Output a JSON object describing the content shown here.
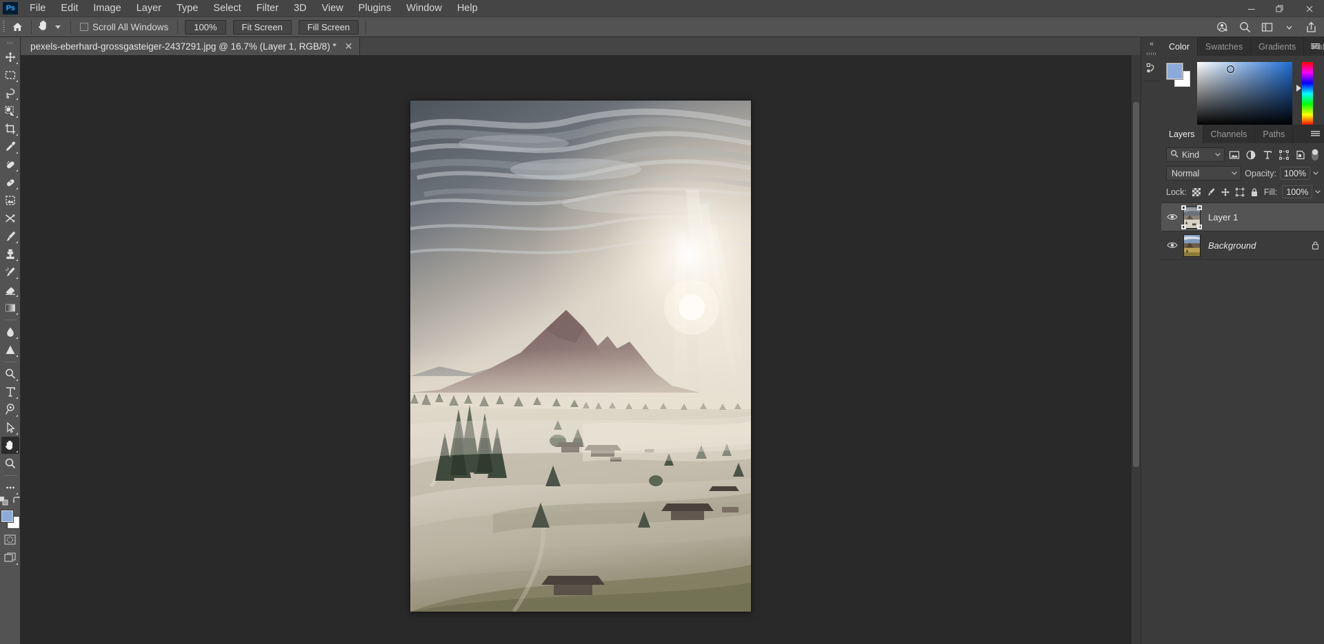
{
  "app": {
    "name": "Adobe Photoshop",
    "logo_text": "Ps"
  },
  "menubar": {
    "items": [
      {
        "label": "File"
      },
      {
        "label": "Edit"
      },
      {
        "label": "Image"
      },
      {
        "label": "Layer"
      },
      {
        "label": "Type"
      },
      {
        "label": "Select"
      },
      {
        "label": "Filter"
      },
      {
        "label": "3D"
      },
      {
        "label": "View"
      },
      {
        "label": "Plugins"
      },
      {
        "label": "Window"
      },
      {
        "label": "Help"
      }
    ],
    "window_controls": {
      "minimize": "—",
      "restore": "❐",
      "close": "✕"
    }
  },
  "options_bar": {
    "home_icon": "home-icon",
    "active_tool_icon": "hand-tool-icon",
    "scroll_all_windows_label": "Scroll All Windows",
    "scroll_all_windows_checked": false,
    "zoom_100_label": "100%",
    "fit_screen_label": "Fit Screen",
    "fill_screen_label": "Fill Screen",
    "right_icons": [
      {
        "name": "share-user-icon"
      },
      {
        "name": "search-icon"
      },
      {
        "name": "workspace-icon"
      },
      {
        "name": "chevron-down-icon"
      },
      {
        "name": "share-export-icon"
      }
    ]
  },
  "toolbar": {
    "tools": [
      {
        "name": "move-tool",
        "label": "Move Tool",
        "icon": "move-icon",
        "has_flyout": true,
        "active": false
      },
      {
        "name": "marquee-tool",
        "label": "Rectangular Marquee Tool",
        "icon": "marquee-icon",
        "has_flyout": true,
        "active": false
      },
      {
        "name": "lasso-tool",
        "label": "Lasso Tool",
        "icon": "lasso-icon",
        "has_flyout": true,
        "active": false
      },
      {
        "name": "quick-selection-tool",
        "label": "Object Selection Tool",
        "icon": "quick-select-icon",
        "has_flyout": true,
        "active": false
      },
      {
        "name": "crop-tool",
        "label": "Crop Tool",
        "icon": "crop-icon",
        "has_flyout": true,
        "active": false
      },
      {
        "name": "eyedropper-tool",
        "label": "Eyedropper Tool",
        "icon": "eyedropper-icon",
        "has_flyout": true,
        "active": false
      },
      {
        "name": "spot-healing-tool",
        "label": "Spot Healing Brush Tool",
        "icon": "healing-brush-icon",
        "has_flyout": true,
        "active": false
      },
      {
        "name": "patch-tool",
        "label": "Patch Tool",
        "icon": "patch-icon",
        "has_flyout": true,
        "active": false
      },
      {
        "name": "frame-tool",
        "label": "Frame Tool",
        "icon": "frame-icon",
        "has_flyout": false,
        "active": false
      },
      {
        "name": "shuffle-tool",
        "label": "Content-Aware Move Tool",
        "icon": "shuffle-icon",
        "has_flyout": false,
        "active": false
      },
      {
        "name": "brush-tool",
        "label": "Brush Tool",
        "icon": "brush-icon",
        "has_flyout": true,
        "active": false
      },
      {
        "name": "clone-stamp-tool",
        "label": "Clone Stamp Tool",
        "icon": "clone-stamp-icon",
        "has_flyout": true,
        "active": false
      },
      {
        "name": "history-brush-tool",
        "label": "History Brush Tool",
        "icon": "history-brush-icon",
        "has_flyout": true,
        "active": false
      },
      {
        "name": "eraser-tool",
        "label": "Eraser Tool",
        "icon": "eraser-icon",
        "has_flyout": true,
        "active": false
      },
      {
        "name": "gradient-tool",
        "label": "Gradient Tool",
        "icon": "gradient-icon",
        "has_flyout": true,
        "active": false
      },
      {
        "name": "blur-tool",
        "label": "Blur Tool",
        "icon": "waterdrop-icon",
        "has_flyout": true,
        "active": false
      },
      {
        "name": "dodge-tool",
        "label": "Dodge Tool",
        "icon": "dodge-icon",
        "has_flyout": true,
        "active": false
      },
      {
        "name": "pen-tool",
        "label": "Pen Tool",
        "icon": "pen-icon",
        "has_flyout": true,
        "active": false
      },
      {
        "name": "type-tool",
        "label": "Horizontal Type Tool",
        "icon": "type-icon",
        "has_flyout": true,
        "active": false
      },
      {
        "name": "shape-tool",
        "label": "Custom Shape Tool",
        "icon": "shape-icon",
        "has_flyout": true,
        "active": false
      },
      {
        "name": "path-selection-tool",
        "label": "Path Selection Tool",
        "icon": "path-arrow-icon",
        "has_flyout": true,
        "active": false
      },
      {
        "name": "hand-tool",
        "label": "Hand Tool",
        "icon": "hand-icon",
        "has_flyout": true,
        "active": true
      },
      {
        "name": "zoom-tool",
        "label": "Zoom Tool",
        "icon": "magnifier-icon",
        "has_flyout": false,
        "active": false
      },
      {
        "name": "edit-toolbar",
        "label": "Edit Toolbar",
        "icon": "ellipsis-icon",
        "has_flyout": true,
        "active": false
      }
    ],
    "default_colors_icon": "default-colors-icon",
    "swap_colors_icon": "swap-colors-icon",
    "foreground_color": "#8aaada",
    "background_color": "#ffffff",
    "quick_mask_icon": "quick-mask-icon",
    "screen_mode_icon": "screen-mode-icon"
  },
  "document": {
    "tab_title": "pexels-eberhard-grossgasteiger-2437291.jpg @ 16.7% (Layer 1, RGB/8) *",
    "filename": "pexels-eberhard-grossgasteiger-2437291.jpg",
    "zoom_level": "16.7%",
    "active_layer": "Layer 1",
    "color_mode": "RGB/8",
    "unsaved_marker": "*",
    "close_icon": "✕"
  },
  "dock_rail": {
    "collapse_icon": "«",
    "buttons": [
      {
        "name": "history-panel-icon"
      }
    ]
  },
  "color_panel": {
    "tabs": [
      {
        "label": "Color",
        "active": true
      },
      {
        "label": "Swatches",
        "active": false
      },
      {
        "label": "Gradients",
        "active": false
      },
      {
        "label": "Patterns",
        "active": false
      }
    ],
    "menu_icon": "panel-menu-icon",
    "foreground_color": "#8aaada",
    "background_color": "#ffffff",
    "picker_hue": "#1f6ed4"
  },
  "layers_panel": {
    "tabs": [
      {
        "label": "Layers",
        "active": true
      },
      {
        "label": "Channels",
        "active": false
      },
      {
        "label": "Paths",
        "active": false
      }
    ],
    "menu_icon": "panel-menu-icon",
    "filter": {
      "search_icon": "search-icon",
      "kind_label": "Kind",
      "filter_icons": [
        {
          "name": "filter-pixel-icon"
        },
        {
          "name": "filter-adjustment-icon"
        },
        {
          "name": "filter-type-icon"
        },
        {
          "name": "filter-shape-icon"
        },
        {
          "name": "filter-smart-object-icon"
        }
      ],
      "toggle_on": false
    },
    "blend_mode": "Normal",
    "opacity_label": "Opacity:",
    "opacity_value": "100%",
    "lock_label": "Lock:",
    "lock_icons": [
      {
        "name": "lock-transparent-pixels-icon"
      },
      {
        "name": "lock-image-pixels-icon"
      },
      {
        "name": "lock-position-icon"
      },
      {
        "name": "lock-artboard-nesting-icon"
      },
      {
        "name": "lock-all-icon"
      }
    ],
    "fill_label": "Fill:",
    "fill_value": "100%",
    "layers": [
      {
        "name": "Layer 1",
        "visible": true,
        "selected": true,
        "locked": false,
        "italic": false,
        "thumbnail": "bright-misty-landscape"
      },
      {
        "name": "Background",
        "visible": true,
        "selected": false,
        "locked": true,
        "italic": true,
        "thumbnail": "warm-landscape"
      }
    ]
  },
  "canvas": {
    "image_description": "Misty alpine meadow at sunrise with mountain peak, sun rays, conifer trees and wooden huts"
  }
}
